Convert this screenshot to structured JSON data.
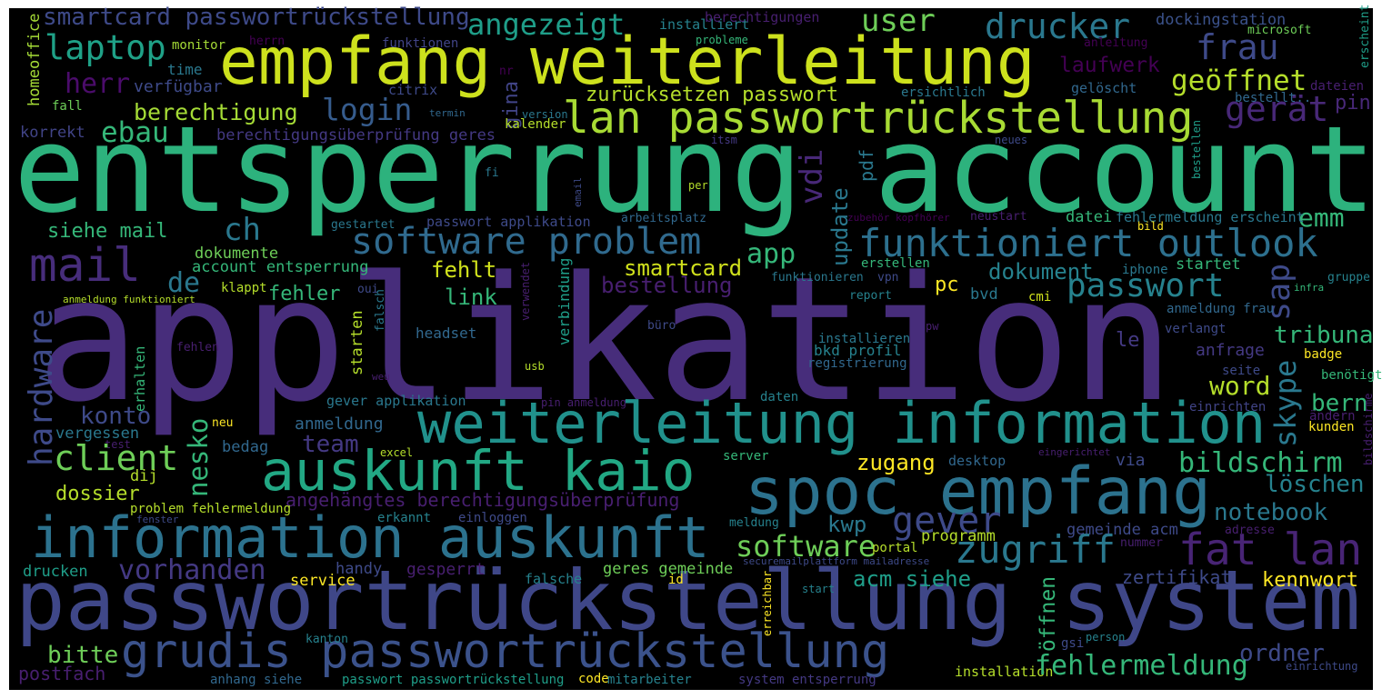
{
  "words": [
    "applikation",
    "entsperrung account",
    "passwortrückstellung system",
    "empfang weiterleitung",
    "weiterleitung information",
    "information auskunft",
    "spoc empfang",
    "auskunft kaio",
    "lan passwortrückstellung",
    "grudis passwortrückstellung",
    "fat lan",
    "mail",
    "funktioniert outlook",
    "software problem",
    "smartcard passwortrückstellung",
    "angezeigt",
    "laptop",
    "herr",
    "login",
    "berechtigung",
    "ebau",
    "berechtigungsüberprüfung geres",
    "korrekt",
    "user",
    "drucker",
    "frau",
    "dockingstation",
    "geöffnet",
    "gerät",
    "laufwerk",
    "zurücksetzen passwort",
    "installiert",
    "berechtigungen",
    "probleme",
    "funktionen",
    "herrn",
    "monitor",
    "time",
    "verfügbar",
    "homeoffice",
    "fall",
    "citrix",
    "nr",
    "gina",
    "termin",
    "version",
    "kalender",
    "fi",
    "microsoft",
    "anleitung",
    "erscheint",
    "gelöscht",
    "ersichtlich",
    "dateien",
    "bestellt..",
    "pin",
    "itsm",
    "neues",
    "vdi",
    "pdf",
    "bestellen",
    "update",
    "ch",
    "siehe mail",
    "emm",
    "app",
    "passwort applikation",
    "arbeitsplatz",
    "gestartet",
    "email",
    "per",
    "zubehör kopfhörer",
    "neustart",
    "datei",
    "fehlermeldung erscheint",
    "bild",
    "dokumente",
    "account entsperrung",
    "fehlt",
    "smartcard",
    "dokument",
    "startet",
    "iphone",
    "sap",
    "gruppe",
    "erstellen",
    "hardware",
    "de",
    "fehler",
    "klappt",
    "anmeldung funktioniert",
    "link",
    "bestellung",
    "pc",
    "funktionieren",
    "vpn",
    "passwort",
    "oui",
    "infra",
    "report",
    "falsch",
    "verwendet",
    "verbindung",
    "starten",
    "headset",
    "büro",
    "fehlen",
    "erhalten",
    "cmi",
    "bvd",
    "tribuna",
    "anmeldung frau",
    "pw",
    "installieren",
    "le",
    "verlangt",
    "usb",
    "weu",
    "gever applikation",
    "pin anmeldung",
    "bkd profil",
    "registrierung",
    "anfrage",
    "badge",
    "seite",
    "benötigt",
    "word",
    "skype",
    "bern",
    "einrichten",
    "ändern",
    "kunden",
    "bildschirme",
    "daten",
    "konto",
    "nesko",
    "neu",
    "anmeldung",
    "vergessen",
    "test",
    "team",
    "bedag",
    "excel",
    "client",
    "dij",
    "dossier",
    "angehängtes berechtigungsüberprüfung",
    "problem fehlermeldung",
    "eingerichtet",
    "server",
    "zugang",
    "desktop",
    "via",
    "bildschirm",
    "löschen",
    "notebook",
    "fenster",
    "erkannt",
    "einloggen",
    "meldung",
    "kwp",
    "gever",
    "gemeinde acm",
    "adresse",
    "programm",
    "nummer",
    "software",
    "portal",
    "zugriff",
    "securemailplattform mailadresse",
    "drucken",
    "vorhanden",
    "handy",
    "gesperrt",
    "geres gemeinde",
    "service",
    "falsche",
    "id",
    "acm siehe",
    "zertifikat",
    "kennwort",
    "start",
    "erreichbar",
    "öffnen",
    "kanton",
    "bitte",
    "postfach",
    "anhang siehe",
    "passwort passwortrückstellung",
    "code",
    "mitarbeiter",
    "gsi",
    "person",
    "ordner",
    "einrichtung",
    "installation",
    "fehlermeldung",
    "system entsperrung"
  ],
  "colors": {
    "background": "#000000",
    "border": "#ffffff"
  }
}
